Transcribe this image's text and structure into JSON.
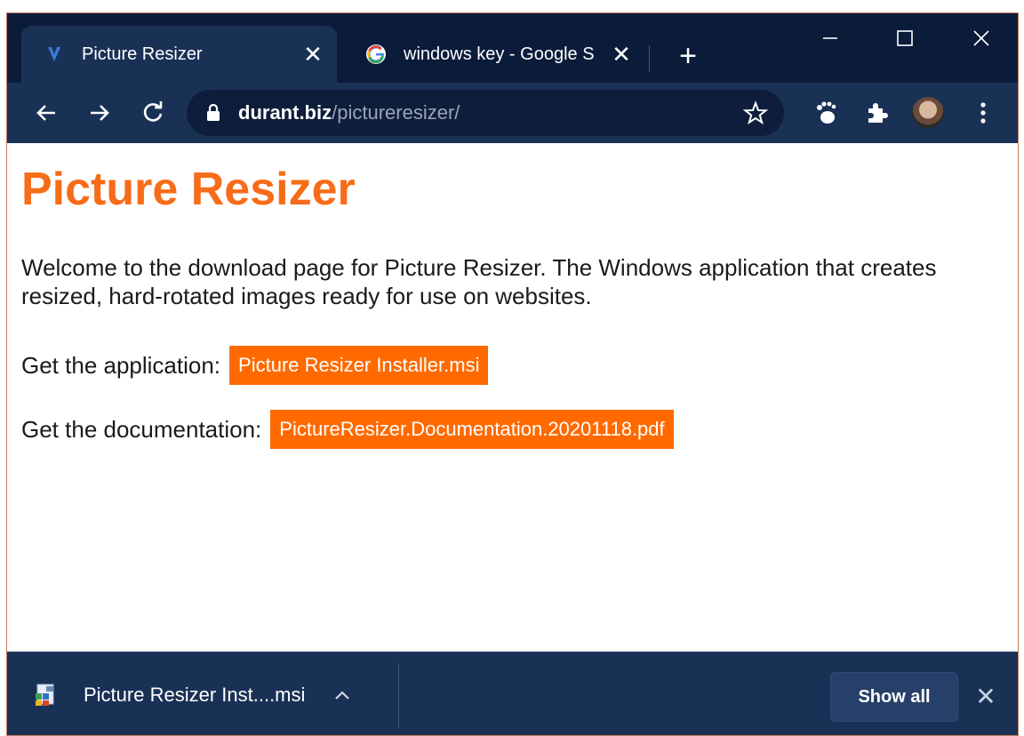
{
  "browser": {
    "tabs": [
      {
        "title": "Picture Resizer",
        "favicon": "picture-resizer-favicon",
        "active": true
      },
      {
        "title": "windows key - Google S",
        "favicon": "google-favicon",
        "active": false
      }
    ],
    "new_tab_label": "+",
    "window_controls": {
      "minimize": "—",
      "maximize": "☐",
      "close": "✕"
    },
    "address": {
      "host": "durant.biz",
      "path": "/pictureresizer/"
    },
    "toolbar_icons": [
      "back-arrow-icon",
      "forward-arrow-icon",
      "reload-icon",
      "lock-icon",
      "star-icon",
      "gnome-foot-icon",
      "extensions-puzzle-icon",
      "profile-avatar",
      "menu-dots-icon"
    ]
  },
  "page": {
    "title": "Picture Resizer",
    "intro": "Welcome to the download page for Picture Resizer. The Windows application that creates resized, hard-rotated images ready for use on websites.",
    "app_label": "Get the application:",
    "app_link": "Picture Resizer Installer.msi",
    "doc_label": "Get the documentation:",
    "doc_link": "PictureResizer.Documentation.20201118.pdf"
  },
  "download_shelf": {
    "item_name": "Picture Resizer Inst....msi",
    "show_all": "Show all",
    "close": "✕"
  },
  "colors": {
    "accent_orange": "#ff6a00",
    "title_orange": "#f76c18",
    "tabstrip": "#0b1b3a",
    "toolbar": "#1a3156"
  }
}
